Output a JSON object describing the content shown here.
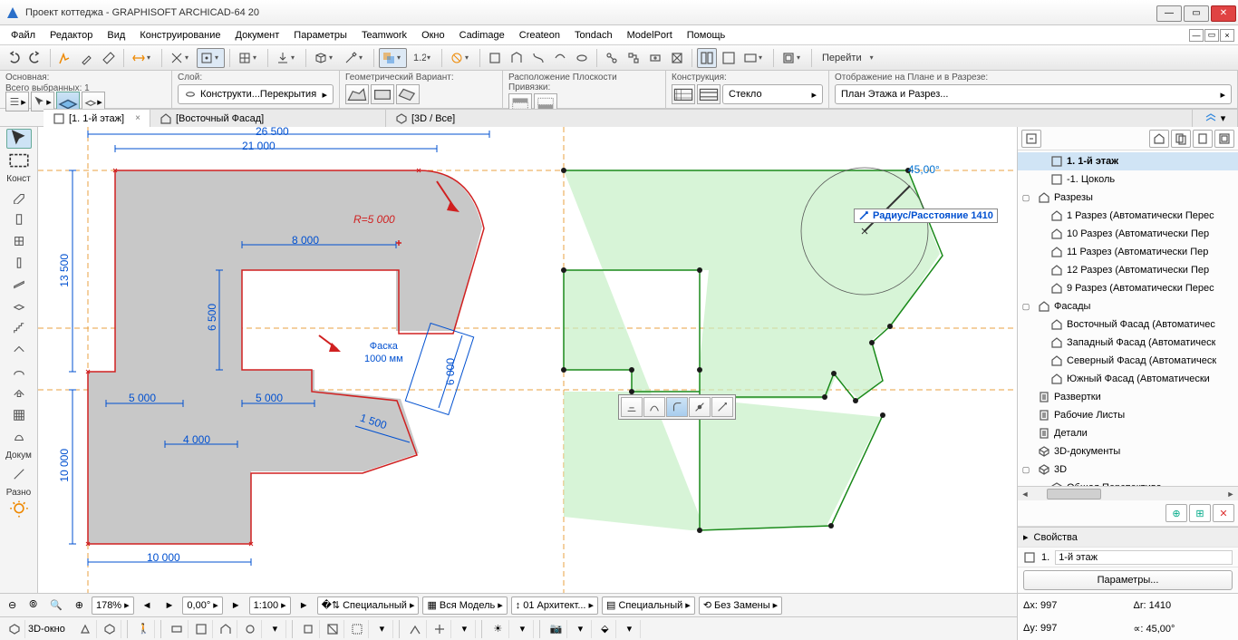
{
  "app": {
    "title": "Проект коттеджа - GRAPHISOFT ARCHICAD-64 20"
  },
  "menu": [
    "Файл",
    "Редактор",
    "Вид",
    "Конструирование",
    "Документ",
    "Параметры",
    "Teamwork",
    "Окно",
    "Cadimage",
    "Createon",
    "Tondach",
    "ModelPort",
    "Помощь"
  ],
  "goto": "Перейти",
  "infobox": {
    "panel1_label": "Основная:",
    "sel_label": "Всего выбранных: 1",
    "layer_label": "Слой:",
    "layer_value": "Конструкти...Перекрытия",
    "geom_label": "Геометрический Вариант:",
    "plane_label": "Расположение Плоскости Привязки:",
    "constr_label": "Конструкция:",
    "constr_value": "Стекло",
    "display_label": "Отображение на Плане и в Разрезе:",
    "display_value": "План Этажа и Разрез..."
  },
  "tabs": [
    {
      "label": "[1. 1-й этаж]",
      "active": true
    },
    {
      "label": "[Восточный Фасад]",
      "active": false
    },
    {
      "label": "[3D / Все]",
      "active": false
    }
  ],
  "toolbox": {
    "hdr1": "Конст",
    "hdr2": "Докум",
    "hdr3": "Разно"
  },
  "tree": [
    {
      "indent": 1,
      "icon": "floor",
      "label": "1. 1-й этаж",
      "sel": true,
      "bold": true
    },
    {
      "indent": 1,
      "icon": "floor",
      "label": "-1. Цоколь"
    },
    {
      "indent": 0,
      "caret": "▢",
      "icon": "house",
      "label": "Разрезы"
    },
    {
      "indent": 1,
      "icon": "house",
      "label": "1 Разрез (Автоматически Перес"
    },
    {
      "indent": 1,
      "icon": "house",
      "label": "10 Разрез (Автоматически Пер"
    },
    {
      "indent": 1,
      "icon": "house",
      "label": "11 Разрез (Автоматически Пер"
    },
    {
      "indent": 1,
      "icon": "house",
      "label": "12 Разрез (Автоматически Пер"
    },
    {
      "indent": 1,
      "icon": "house",
      "label": "9 Разрез (Автоматически Перес"
    },
    {
      "indent": 0,
      "caret": "▢",
      "icon": "house",
      "label": "Фасады"
    },
    {
      "indent": 1,
      "icon": "house",
      "label": "Восточный Фасад (Автоматичес"
    },
    {
      "indent": 1,
      "icon": "house",
      "label": "Западный Фасад (Автоматическ"
    },
    {
      "indent": 1,
      "icon": "house",
      "label": "Северный Фасад (Автоматическ"
    },
    {
      "indent": 1,
      "icon": "house",
      "label": "Южный Фасад (Автоматически"
    },
    {
      "indent": 0,
      "caret": "",
      "icon": "sheet",
      "label": "Развертки"
    },
    {
      "indent": 0,
      "caret": "",
      "icon": "sheet",
      "label": "Рабочие Листы"
    },
    {
      "indent": 0,
      "caret": "",
      "icon": "sheet",
      "label": "Детали"
    },
    {
      "indent": 0,
      "caret": "",
      "icon": "cube",
      "label": "3D-документы"
    },
    {
      "indent": 0,
      "caret": "▢",
      "icon": "cube",
      "label": "3D"
    },
    {
      "indent": 1,
      "icon": "cube",
      "label": "Общая Перспектива"
    }
  ],
  "props": {
    "header": "Свойства",
    "id": "1.",
    "name": "1-й этаж",
    "btn": "Параметры..."
  },
  "status": {
    "zoom": "178%",
    "angle": "0,00°",
    "scale": "1:100",
    "s1": "Специальный",
    "s2": "Вся Модель",
    "s3": "01 Архитект...",
    "s4": "Специальный",
    "s5": "Без Замены"
  },
  "bottom": {
    "label3d": "3D-окно"
  },
  "coords": {
    "dx": "Δx: 997",
    "dy": "Δy: 997",
    "dr": "Δr: 1410",
    "da": "∝: 45,00°"
  },
  "canvas": {
    "dims": {
      "d26500": "26 500",
      "d21000": "21 000",
      "r5000": "R=5 000",
      "d8000": "8 000",
      "d13500": "13 500",
      "d6500": "6 500",
      "d5000a": "5 000",
      "d5000b": "5 000",
      "d4000": "4 000",
      "d10000a": "10 000",
      "d10000b": "10 000",
      "d6000": "6 000",
      "d1500": "1 500",
      "faska1": "Фаска",
      "faska2": "1000 мм",
      "angle45": "45,00°"
    },
    "tooltip": "Радиус/Расстояние  1410"
  }
}
